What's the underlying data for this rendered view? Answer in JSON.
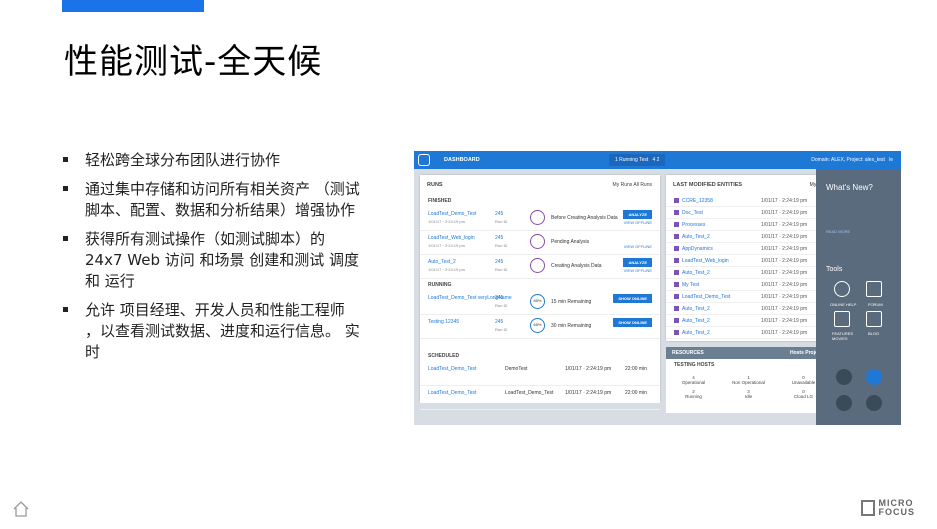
{
  "slide": {
    "title": "性能测试-全天候",
    "bullets": [
      "轻松跨全球分布团队进行协作",
      "通过集中存储和访问所有相关资产 （测试脚本、配置、数据和分析结果）增强协作",
      "获得所有测试操作（如测试脚本）的 24x7 Web 访问 和场景 创建和测试 调度和 运行",
      "允许 项目经理、开发人员和性能工程师 ，以查看测试数据、进度和运行信息。 实时"
    ],
    "brand_line1": "MICRO",
    "brand_line2": "FOCUS",
    "accent": "#1a73e8"
  },
  "dashboard": {
    "nav_title": "DASHBOARD",
    "running_badge": "1 Running Test",
    "running_icons": "4  2",
    "domain_text": "Domain: ALEX, Project: alex_test",
    "user": "le",
    "runs": {
      "title": "RUNS",
      "toggle": "My Runs  All Runs",
      "finished_label": "FINISHED",
      "finished": [
        {
          "name": "LoadTest_Demo_Test",
          "date": "1/01/17 · 2:24:19 pm",
          "id": "245",
          "id_label": "Run ID",
          "status": "Before Creating Analysis Data",
          "btn": "ANALYZE",
          "link": "VIEW OFFLINE"
        },
        {
          "name": "LoadTest_Web_login",
          "date": "1/01/17 · 2:24:19 pm",
          "id": "245",
          "id_label": "Run ID",
          "status": "Pending Analysis",
          "btn": "",
          "link": "VIEW OFFLINE"
        },
        {
          "name": "Auto_Test_2",
          "date": "1/01/17 · 2:24:19 pm",
          "id": "245",
          "id_label": "Run ID",
          "status": "Creating Analysis Data",
          "btn": "ANALYZE",
          "link": "VIEW OFFLINE"
        }
      ],
      "running_label": "RUNNING",
      "running": [
        {
          "name": "LoadTest_Demo_Test veryLongName",
          "id": "245",
          "id_label": "Run ID",
          "pct": "85%",
          "status": "15 min Remaining",
          "btn": "SHOW ONLINE"
        },
        {
          "name": "Testing 12345",
          "id": "245",
          "id_label": "Run ID",
          "pct": "65%",
          "status": "30 min Remaining",
          "btn": "SHOW ONLINE"
        }
      ],
      "scheduled_label": "SCHEDULED",
      "scheduled": [
        {
          "name": "LoadTest_Demo_Test",
          "test": "DemoTest",
          "date": "1/01/17 · 2:24:19 pm",
          "dur": "22:00 min"
        },
        {
          "name": "LoadTest_Demo_Test",
          "test": "LoadTest_Demo_Test",
          "date": "1/01/17 · 2:24:19 pm",
          "dur": "22:00 min"
        }
      ]
    },
    "modified": {
      "title": "LAST MODIFIED ENTITIES",
      "toggle": "My  All",
      "items": [
        {
          "name": "CCRE_12358",
          "date": "1/01/17 · 2:24:19 pm"
        },
        {
          "name": "Doc_Test",
          "date": "1/01/17 · 2:24:19 pm"
        },
        {
          "name": "Processes",
          "date": "1/01/17 · 2:24:19 pm"
        },
        {
          "name": "Auto_Test_2",
          "date": "1/01/17 · 2:24:19 pm"
        },
        {
          "name": "AppDynamics",
          "date": "1/01/17 · 2:24:19 pm"
        },
        {
          "name": "LoadTest_Web_login",
          "date": "1/01/17 · 2:24:19 pm"
        },
        {
          "name": "Auto_Test_2",
          "date": "1/01/17 · 2:24:19 pm"
        },
        {
          "name": "My Test",
          "date": "1/01/17 · 2:24:19 pm"
        },
        {
          "name": "LoadTest_Demo_Test",
          "date": "1/01/17 · 2:24:19 pm"
        },
        {
          "name": "Auto_Test_2",
          "date": "1/01/17 · 2:24:19 pm"
        },
        {
          "name": "Auto_Test_2",
          "date": "1/01/17 · 2:24:19 pm"
        },
        {
          "name": "Auto_Test_2",
          "date": "1/01/17 · 2:24:19 pm"
        }
      ]
    },
    "resources": {
      "title": "RESOURCES",
      "toggle": "Hosts  Projects",
      "sub": "TESTING HOSTS",
      "cells": [
        {
          "v": "4",
          "l": "Operational"
        },
        {
          "v": "1",
          "l": "Non Operational"
        },
        {
          "v": "0",
          "l": "Unavailable"
        },
        {
          "v": "2",
          "l": "Running"
        },
        {
          "v": "3",
          "l": "Idle"
        },
        {
          "v": "0",
          "l": "Cloud LG"
        }
      ]
    },
    "side": {
      "whats_new": "What's New?",
      "read_more": "READ MORE",
      "tools": "Tools",
      "online_help": "ONLINE HELP",
      "forum": "FORUM",
      "features": "FEATURES MOVIES",
      "blog": "BLOG"
    }
  }
}
